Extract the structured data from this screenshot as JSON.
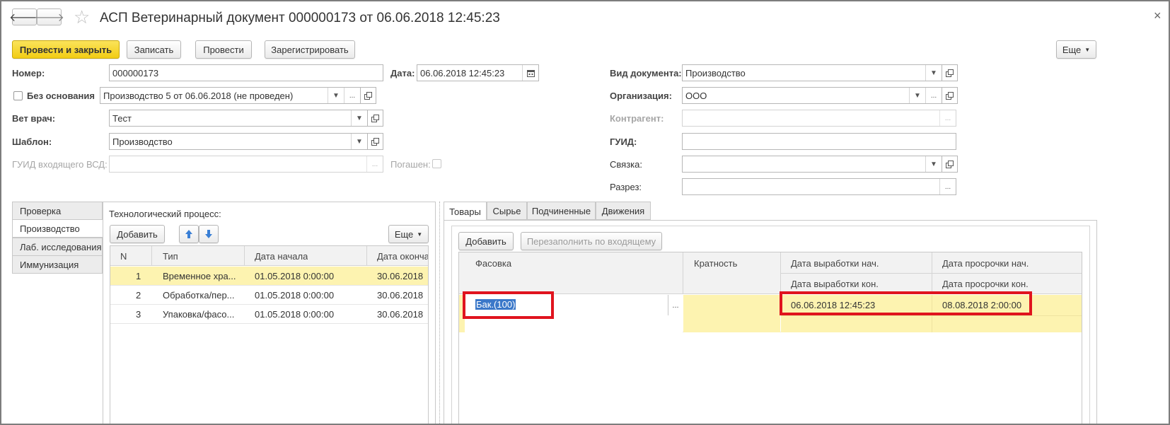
{
  "window": {
    "title": "АСП Ветеринарный документ 000000173 от 06.06.2018 12:45:23",
    "close_glyph": "×"
  },
  "nav": {
    "back_glyph": "🡐",
    "forward_glyph": "🡒",
    "star_glyph": "☆"
  },
  "toolbar": {
    "post_close_label": "Провести и закрыть",
    "save_label": "Записать",
    "post_label": "Провести",
    "register_label": "Зарегистрировать",
    "more_label": "Еще"
  },
  "form": {
    "number_label": "Номер:",
    "number_value": "000000173",
    "date_label": "Дата:",
    "date_value": "06.06.2018 12:45:23",
    "no_basis_label": "Без основания",
    "basis_value": "Производство 5 от 06.06.2018 (не проведен)",
    "vet_label": "Вет врач:",
    "vet_value": "Тест",
    "template_label": "Шаблон:",
    "template_value": "Производство",
    "guid_in_label": "ГУИД входящего ВСД:",
    "guid_in_value": "",
    "repaid_label": "Погашен:",
    "doctype_label": "Вид документа:",
    "doctype_value": "Производство",
    "org_label": "Организация:",
    "org_value": "ООО",
    "counterparty_label": "Контрагент:",
    "counterparty_value": "",
    "guid_label": "ГУИД:",
    "guid_value": "",
    "link_label": "Связка:",
    "link_value": "",
    "section_label": "Разрез:",
    "section_value": ""
  },
  "left_tabs": [
    {
      "label": "Проверка"
    },
    {
      "label": "Производство"
    },
    {
      "label": "Лаб. исследования"
    },
    {
      "label": "Иммунизация"
    }
  ],
  "process": {
    "title": "Технологический процесс:",
    "add_label": "Добавить",
    "more_label": "Еще",
    "columns": [
      "N",
      "Тип",
      "Дата начала",
      "Дата оконча"
    ],
    "rows": [
      {
        "n": "1",
        "type": "Временное хра...",
        "start": "01.05.2018 0:00:00",
        "end": "30.06.2018"
      },
      {
        "n": "2",
        "type": "Обработка/пер...",
        "start": "01.05.2018 0:00:00",
        "end": "30.06.2018"
      },
      {
        "n": "3",
        "type": "Упаковка/фасо...",
        "start": "01.05.2018 0:00:00",
        "end": "30.06.2018"
      }
    ]
  },
  "right_tabs": [
    {
      "label": "Товары"
    },
    {
      "label": "Сырье"
    },
    {
      "label": "Подчиненные"
    },
    {
      "label": "Движения"
    }
  ],
  "goods": {
    "add_label": "Добавить",
    "refill_label": "Перезаполнить по входящему",
    "col_packing": "Фасовка",
    "col_multiplicity": "Кратность",
    "col_prod_start": "Дата выработки нач.",
    "col_prod_end": "Дата выработки кон.",
    "col_exp_start": "Дата просрочки нач.",
    "col_exp_end": "Дата просрочки кон.",
    "row": {
      "packing": "Бак.(100)",
      "dots": "...",
      "prod_start": "06.06.2018 12:45:23",
      "exp_start": "08.08.2018 2:00:00"
    }
  },
  "colors": {
    "primary_button": "#f2cd14",
    "selected_row": "#fdf3b0",
    "highlight_box": "#e0141e",
    "arrow_blue": "#3a7fd5"
  }
}
